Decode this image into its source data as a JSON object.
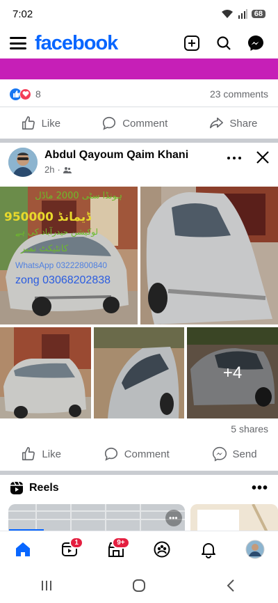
{
  "status_bar": {
    "time": "7:02",
    "battery": "68"
  },
  "app": {
    "logo": "facebook"
  },
  "prev_post": {
    "reaction_count": "8",
    "comments": "23 comments"
  },
  "actions": {
    "like": "Like",
    "comment": "Comment",
    "share": "Share",
    "send": "Send"
  },
  "post": {
    "author": "Abdul Qayoum Qaim Khani",
    "time": "2h",
    "overlay": {
      "line1": "ہونڈا سٹی 2000 ماڈل",
      "line2": "ڈیمانڈ 950000",
      "line3": "لوکیشن حیدرآباد کی ہے",
      "line4": "کانٹیکٹ نمبر",
      "line5": "WhatsApp 03222800840",
      "line6": "zong 03068202838"
    },
    "more_photos": "+4",
    "shares": "5 shares"
  },
  "reels": {
    "title": "Reels"
  },
  "nav": {
    "video_badge": "1",
    "marketplace_badge": "9+"
  },
  "colors": {
    "brand": "#0866ff",
    "banner": "#c61fb7",
    "badge": "#e41e3f"
  }
}
